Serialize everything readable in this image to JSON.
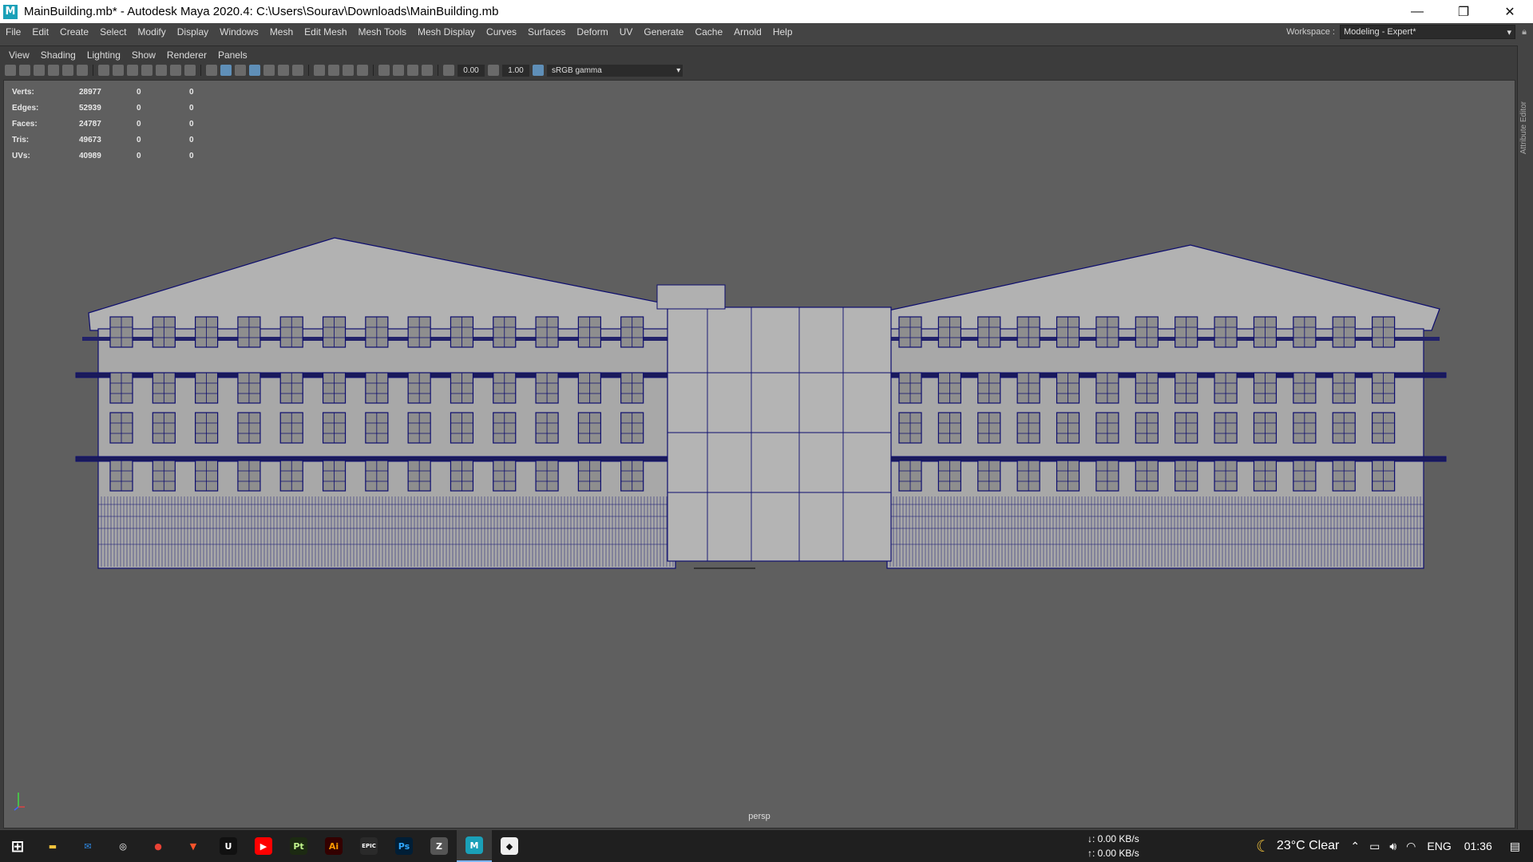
{
  "window": {
    "title": "MainBuilding.mb* - Autodesk Maya 2020.4: C:\\Users\\Sourav\\Downloads\\MainBuilding.mb",
    "app_icon_letter": "M",
    "minimize": "—",
    "restore": "❐",
    "close": "✕"
  },
  "menubar": {
    "items": [
      "File",
      "Edit",
      "Create",
      "Select",
      "Modify",
      "Display",
      "Windows",
      "Mesh",
      "Edit Mesh",
      "Mesh Tools",
      "Mesh Display",
      "Curves",
      "Surfaces",
      "Deform",
      "UV",
      "Generate",
      "Cache",
      "Arnold",
      "Help"
    ],
    "workspace_label": "Workspace :",
    "workspace_value": "Modeling - Expert*"
  },
  "panel_menu": [
    "View",
    "Shading",
    "Lighting",
    "Show",
    "Renderer",
    "Panels"
  ],
  "toolbar": {
    "field1": "0.00",
    "field2": "1.00",
    "colorspace": "sRGB gamma"
  },
  "hud": {
    "rows": [
      {
        "label": "Verts:",
        "v1": "28977",
        "v2": "0",
        "v3": "0"
      },
      {
        "label": "Edges:",
        "v1": "52939",
        "v2": "0",
        "v3": "0"
      },
      {
        "label": "Faces:",
        "v1": "24787",
        "v2": "0",
        "v3": "0"
      },
      {
        "label": "Tris:",
        "v1": "49673",
        "v2": "0",
        "v3": "0"
      },
      {
        "label": "UVs:",
        "v1": "40989",
        "v2": "0",
        "v3": "0"
      }
    ]
  },
  "viewport": {
    "camera": "persp",
    "wire_color": "#0d0d6e",
    "mesh_color": "#a8a8a8"
  },
  "right_strip": {
    "label": "Attribute Editor"
  },
  "taskbar": {
    "net_down": "↓: 0.00 KB/s",
    "net_up": "↑: 0.00 KB/s",
    "weather": "23°C  Clear",
    "lang": "ENG",
    "time": "01:36",
    "apps": [
      {
        "name": "start",
        "glyph": "⊞",
        "color": "#ffffff",
        "bg": "transparent"
      },
      {
        "name": "file-explorer",
        "glyph": "▬",
        "color": "#f3c33c",
        "bg": "transparent"
      },
      {
        "name": "mail",
        "glyph": "✉",
        "color": "#2e8ae6",
        "bg": "transparent"
      },
      {
        "name": "search",
        "glyph": "◎",
        "color": "#ffffff",
        "bg": "transparent"
      },
      {
        "name": "chrome",
        "glyph": "●",
        "color": "#e94235",
        "bg": "transparent"
      },
      {
        "name": "brave",
        "glyph": "▼",
        "color": "#fb542b",
        "bg": "transparent"
      },
      {
        "name": "unreal",
        "glyph": "U",
        "color": "#ffffff",
        "bg": "#111111"
      },
      {
        "name": "youtube",
        "glyph": "▶",
        "color": "#ffffff",
        "bg": "#ff0000"
      },
      {
        "name": "premiere",
        "glyph": "Pt",
        "color": "#c2f58d",
        "bg": "#1c2a12"
      },
      {
        "name": "illustrator",
        "glyph": "Ai",
        "color": "#ff9a00",
        "bg": "#330000"
      },
      {
        "name": "epic-games",
        "glyph": "EPIC",
        "color": "#ffffff",
        "bg": "#2a2a2a"
      },
      {
        "name": "photoshop",
        "glyph": "Ps",
        "color": "#31a8ff",
        "bg": "#001e36"
      },
      {
        "name": "zbrush",
        "glyph": "Z",
        "color": "#ffffff",
        "bg": "#555555"
      },
      {
        "name": "maya",
        "glyph": "M",
        "color": "#ffffff",
        "bg": "#1aa0b8"
      },
      {
        "name": "unity",
        "glyph": "◆",
        "color": "#111111",
        "bg": "#eeeeee"
      }
    ]
  }
}
